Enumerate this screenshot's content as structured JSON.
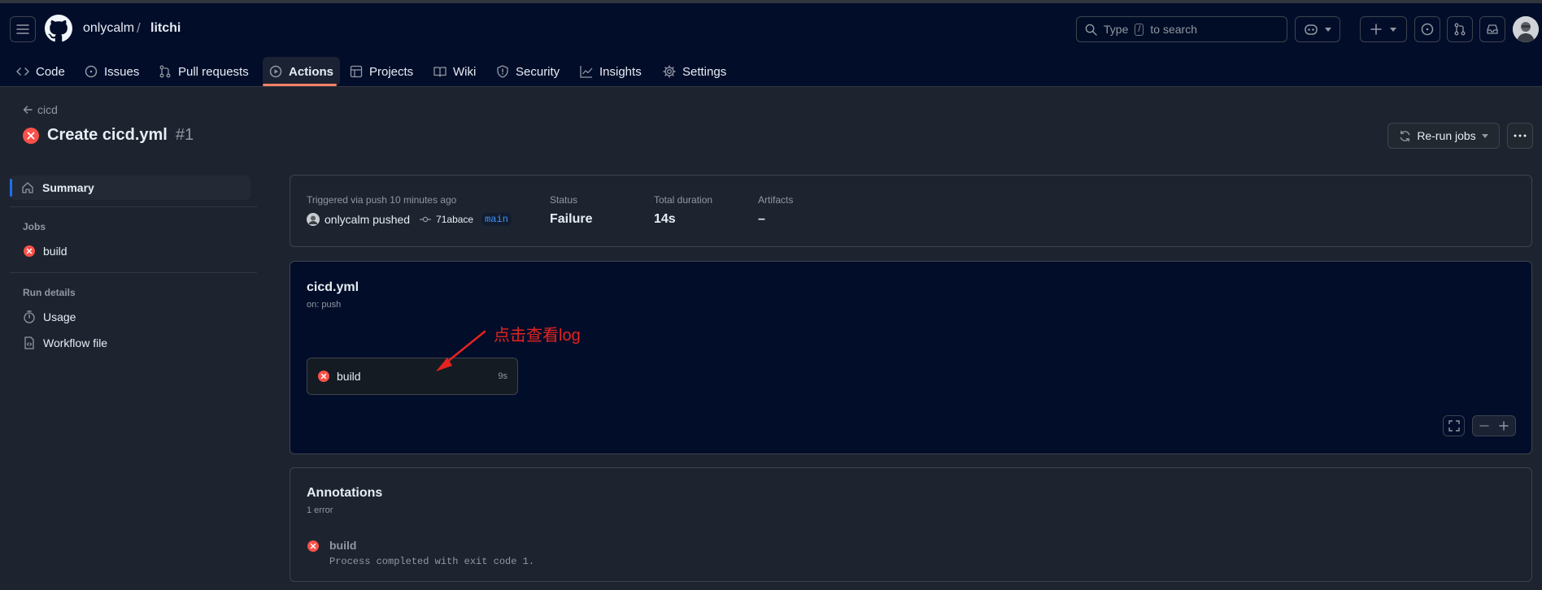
{
  "header": {
    "owner": "onlycalm",
    "separator": "/",
    "repo": "litchi",
    "search": {
      "prefix": "Type",
      "kbd": "/",
      "suffix": "to search"
    }
  },
  "nav": {
    "tabs": [
      {
        "label": "Code",
        "icon": "code-icon"
      },
      {
        "label": "Issues",
        "icon": "issue-icon"
      },
      {
        "label": "Pull requests",
        "icon": "pull-request-icon"
      },
      {
        "label": "Actions",
        "icon": "play-icon",
        "active": true
      },
      {
        "label": "Projects",
        "icon": "table-icon"
      },
      {
        "label": "Wiki",
        "icon": "book-icon"
      },
      {
        "label": "Security",
        "icon": "shield-icon"
      },
      {
        "label": "Insights",
        "icon": "graph-icon"
      },
      {
        "label": "Settings",
        "icon": "gear-icon"
      }
    ]
  },
  "run": {
    "back_label": "cicd",
    "title": "Create cicd.yml",
    "number": "#1",
    "rerun_label": "Re-run jobs",
    "status_color": "#f85149"
  },
  "sidebar": {
    "summary": "Summary",
    "jobs_heading": "Jobs",
    "job": "build",
    "run_details_heading": "Run details",
    "usage": "Usage",
    "workflow_file": "Workflow file"
  },
  "summary_card": {
    "trigger_label": "Triggered via push 10 minutes ago",
    "actor": "onlycalm pushed",
    "commit": "71abace",
    "branch": "main",
    "status_label": "Status",
    "status_value": "Failure",
    "duration_label": "Total duration",
    "duration_value": "14s",
    "artifacts_label": "Artifacts",
    "artifacts_value": "–"
  },
  "workflow": {
    "name": "cicd.yml",
    "trigger": "on: push",
    "job_name": "build",
    "job_duration": "9s",
    "annotation_text": "点击查看log",
    "annotation_color": "#e5231f"
  },
  "annotations": {
    "title": "Annotations",
    "count": "1 error",
    "item_title": "build",
    "item_message": "Process completed with exit code 1."
  }
}
